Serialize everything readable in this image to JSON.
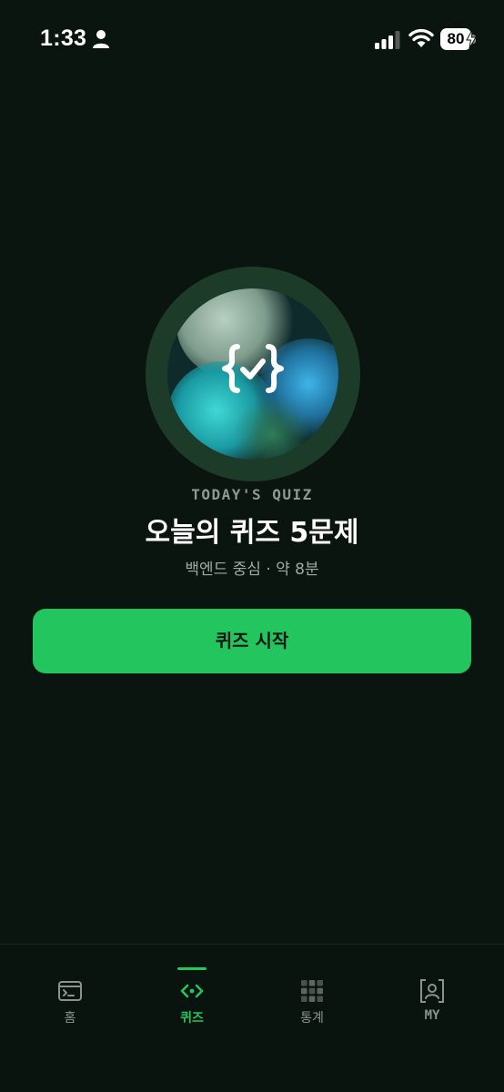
{
  "status_bar": {
    "time": "1:33",
    "battery_level": "80",
    "icons": [
      "person-icon",
      "signal-icon",
      "wifi-icon",
      "battery-icon",
      "bolt-icon"
    ]
  },
  "hero": {
    "icon": "code-check-icon",
    "kicker": "TODAY'S QUIZ",
    "title": "오늘의 퀴즈 5문제",
    "subtitle": "백엔드 중심 · 약 8분"
  },
  "start_button": {
    "label": "퀴즈 시작"
  },
  "tab_bar": {
    "active_tab": "quiz",
    "tabs": [
      {
        "id": "home",
        "label": "홈",
        "icon": "terminal-icon"
      },
      {
        "id": "quiz",
        "label": "퀴즈",
        "icon": "code-icon"
      },
      {
        "id": "stats",
        "label": "통계",
        "icon": "grid-icon"
      },
      {
        "id": "my",
        "label": "MY",
        "icon": "user-frame-icon"
      }
    ]
  },
  "colors": {
    "background": "#0b1510",
    "accent": "#22c55e",
    "ring": "#1c3b29",
    "muted_text": "#a0aaa4"
  }
}
